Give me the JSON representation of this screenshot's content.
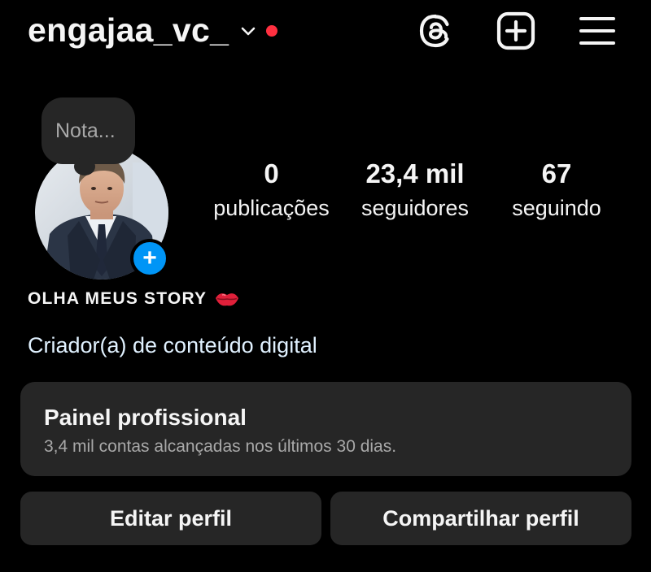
{
  "header": {
    "username": "engajaa_vc_",
    "accent_dot_color": "#ff3040",
    "icons": [
      "chevron-down-icon",
      "threads-icon",
      "add-post-icon",
      "menu-icon"
    ]
  },
  "note": {
    "placeholder": "Nota..."
  },
  "profile": {
    "avatar_badge": "+",
    "stats": [
      {
        "value": "0",
        "label": "publicações"
      },
      {
        "value": "23,4 mil",
        "label": "seguidores"
      },
      {
        "value": "67",
        "label": "seguindo"
      }
    ],
    "display_name": "OLHA MEUS STORY",
    "display_name_emoji": "lips-kiss-icon",
    "category": "Criador(a) de conteúdo digital"
  },
  "dashboard": {
    "title": "Painel profissional",
    "subtitle": "3,4 mil contas alcançadas nos últimos 30 dias."
  },
  "actions": {
    "edit_label": "Editar perfil",
    "share_label": "Compartilhar perfil"
  },
  "colors": {
    "background": "#000000",
    "surface": "#262626",
    "primary_blue": "#0095f6",
    "category_text": "#e0f1ff"
  }
}
